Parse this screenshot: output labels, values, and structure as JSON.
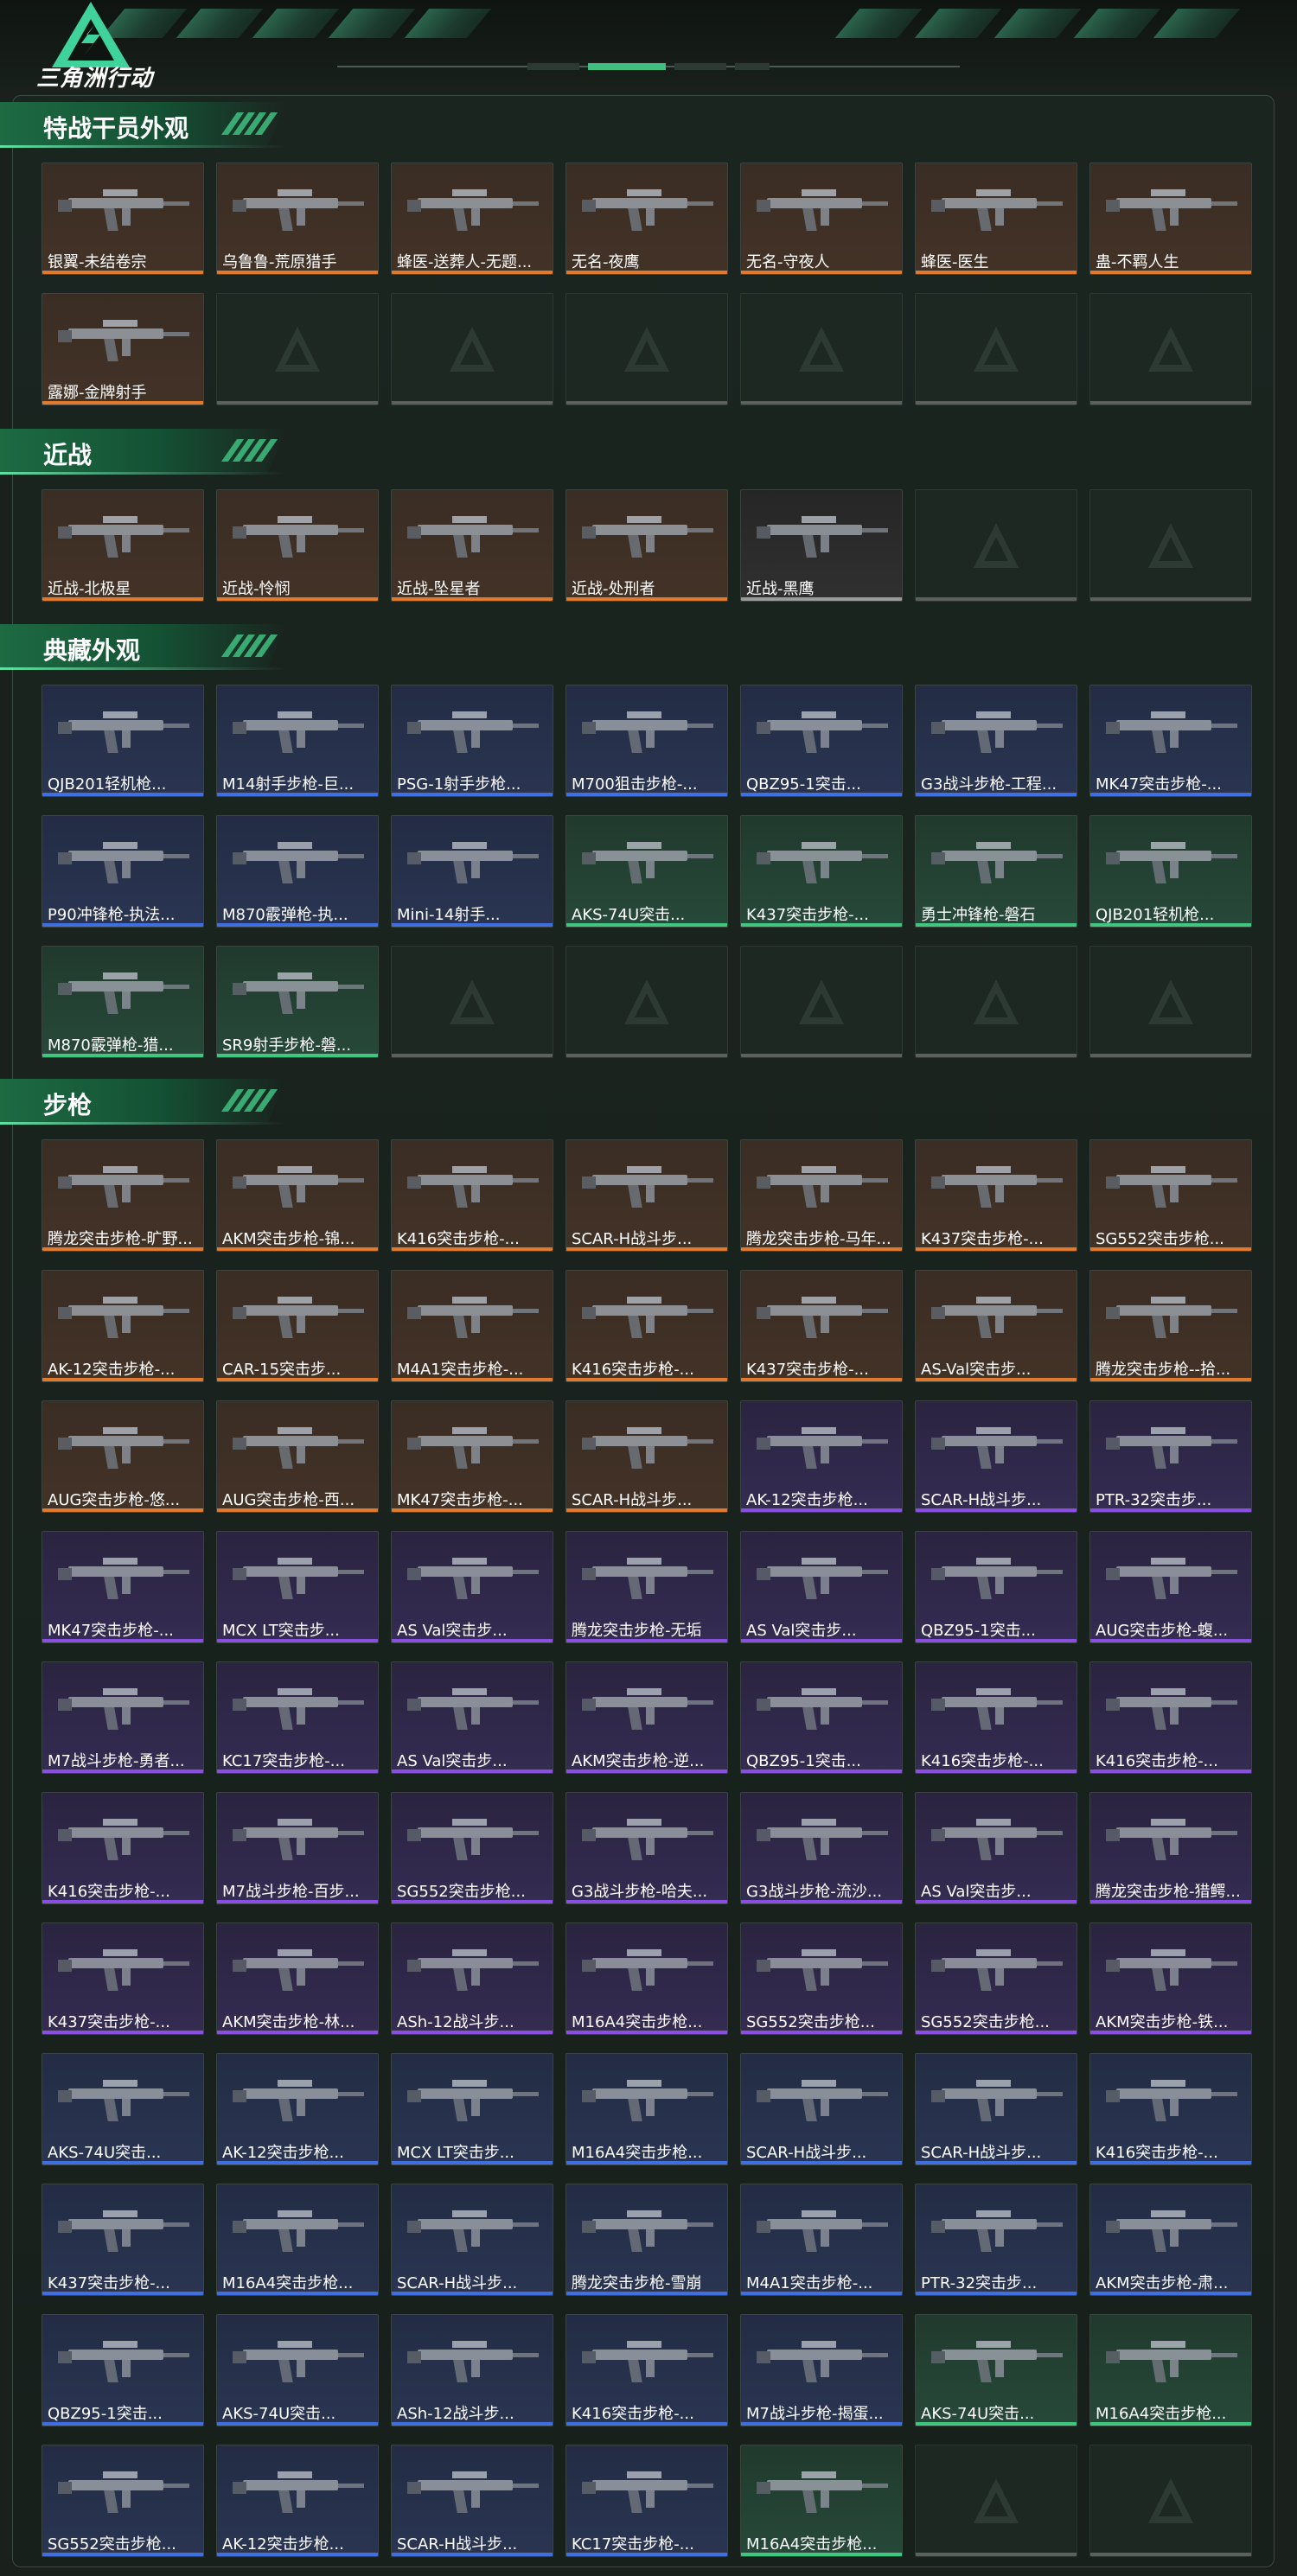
{
  "header": {
    "logo_text": "三角洲行动"
  },
  "colors": {
    "orange": "#e07a2e",
    "blue": "#3f6fe0",
    "green": "#3ec77d",
    "purple": "#8a4fe0",
    "gray": "#9a9a9a",
    "accent": "#1d6a43"
  },
  "sections": [
    {
      "title": "特战干员外观",
      "items": [
        {
          "label": "银翼-未结卷宗",
          "tier": "orange"
        },
        {
          "label": "乌鲁鲁-荒原猎手",
          "tier": "orange"
        },
        {
          "label": "蜂医-送葬人-无题...",
          "tier": "orange"
        },
        {
          "label": "无名-夜鹰",
          "tier": "orange"
        },
        {
          "label": "无名-守夜人",
          "tier": "orange"
        },
        {
          "label": "蜂医-医生",
          "tier": "orange"
        },
        {
          "label": "蛊-不羁人生",
          "tier": "orange"
        },
        {
          "label": "露娜-金牌射手",
          "tier": "orange"
        },
        {
          "label": "",
          "tier": "empty"
        },
        {
          "label": "",
          "tier": "empty"
        },
        {
          "label": "",
          "tier": "empty"
        },
        {
          "label": "",
          "tier": "empty"
        },
        {
          "label": "",
          "tier": "empty"
        },
        {
          "label": "",
          "tier": "empty"
        }
      ]
    },
    {
      "title": "近战",
      "items": [
        {
          "label": "近战-北极星",
          "tier": "orange"
        },
        {
          "label": "近战-怜悯",
          "tier": "orange"
        },
        {
          "label": "近战-坠星者",
          "tier": "orange"
        },
        {
          "label": "近战-处刑者",
          "tier": "orange"
        },
        {
          "label": "近战-黑鹰",
          "tier": "gray"
        },
        {
          "label": "",
          "tier": "empty"
        },
        {
          "label": "",
          "tier": "empty"
        }
      ]
    },
    {
      "title": "典藏外观",
      "items": [
        {
          "label": "QJB201轻机枪...",
          "tier": "blue"
        },
        {
          "label": "M14射手步枪-巨...",
          "tier": "blue"
        },
        {
          "label": "PSG-1射手步枪...",
          "tier": "blue"
        },
        {
          "label": "M700狙击步枪-...",
          "tier": "blue"
        },
        {
          "label": "QBZ95-1突击...",
          "tier": "blue"
        },
        {
          "label": "G3战斗步枪-工程...",
          "tier": "blue"
        },
        {
          "label": "MK47突击步枪-...",
          "tier": "blue"
        },
        {
          "label": "P90冲锋枪-执法...",
          "tier": "blue"
        },
        {
          "label": "M870霰弹枪-执...",
          "tier": "blue"
        },
        {
          "label": "Mini-14射手...",
          "tier": "blue"
        },
        {
          "label": "AKS-74U突击...",
          "tier": "green"
        },
        {
          "label": "K437突击步枪-...",
          "tier": "green"
        },
        {
          "label": "勇士冲锋枪-磐石",
          "tier": "green"
        },
        {
          "label": "QJB201轻机枪...",
          "tier": "green"
        },
        {
          "label": "M870霰弹枪-猎...",
          "tier": "green"
        },
        {
          "label": "SR9射手步枪-磐...",
          "tier": "green"
        },
        {
          "label": "",
          "tier": "empty"
        },
        {
          "label": "",
          "tier": "empty"
        },
        {
          "label": "",
          "tier": "empty"
        },
        {
          "label": "",
          "tier": "empty"
        },
        {
          "label": "",
          "tier": "empty"
        }
      ]
    },
    {
      "title": "步枪",
      "items": [
        {
          "label": "腾龙突击步枪-旷野...",
          "tier": "orange"
        },
        {
          "label": "AKM突击步枪-锦...",
          "tier": "orange"
        },
        {
          "label": "K416突击步枪-...",
          "tier": "orange"
        },
        {
          "label": "SCAR-H战斗步...",
          "tier": "orange"
        },
        {
          "label": "腾龙突击步枪-马年...",
          "tier": "orange"
        },
        {
          "label": "K437突击步枪-...",
          "tier": "orange"
        },
        {
          "label": "SG552突击步枪...",
          "tier": "orange"
        },
        {
          "label": "AK-12突击步枪-...",
          "tier": "orange"
        },
        {
          "label": "CAR-15突击步...",
          "tier": "orange"
        },
        {
          "label": "M4A1突击步枪-...",
          "tier": "orange"
        },
        {
          "label": "K416突击步枪-...",
          "tier": "orange"
        },
        {
          "label": "K437突击步枪-...",
          "tier": "orange"
        },
        {
          "label": "AS-Val突击步...",
          "tier": "orange"
        },
        {
          "label": "腾龙突击步枪--拾...",
          "tier": "orange"
        },
        {
          "label": "AUG突击步枪-悠...",
          "tier": "orange"
        },
        {
          "label": "AUG突击步枪-西...",
          "tier": "orange"
        },
        {
          "label": "MK47突击步枪-...",
          "tier": "orange"
        },
        {
          "label": "SCAR-H战斗步...",
          "tier": "orange"
        },
        {
          "label": "AK-12突击步枪...",
          "tier": "purple"
        },
        {
          "label": "SCAR-H战斗步...",
          "tier": "purple"
        },
        {
          "label": "PTR-32突击步...",
          "tier": "purple"
        },
        {
          "label": "MK47突击步枪-...",
          "tier": "purple"
        },
        {
          "label": "MCX LT突击步...",
          "tier": "purple"
        },
        {
          "label": "AS Val突击步...",
          "tier": "purple"
        },
        {
          "label": "腾龙突击步枪-无垢",
          "tier": "purple"
        },
        {
          "label": "AS Val突击步...",
          "tier": "purple"
        },
        {
          "label": "QBZ95-1突击...",
          "tier": "purple"
        },
        {
          "label": "AUG突击步枪-蝮...",
          "tier": "purple"
        },
        {
          "label": "M7战斗步枪-勇者...",
          "tier": "purple"
        },
        {
          "label": "KC17突击步枪-...",
          "tier": "purple"
        },
        {
          "label": "AS Val突击步...",
          "tier": "purple"
        },
        {
          "label": "AKM突击步枪-逆...",
          "tier": "purple"
        },
        {
          "label": "QBZ95-1突击...",
          "tier": "purple"
        },
        {
          "label": "K416突击步枪-...",
          "tier": "purple"
        },
        {
          "label": "K416突击步枪-...",
          "tier": "purple"
        },
        {
          "label": "K416突击步枪-...",
          "tier": "purple"
        },
        {
          "label": "M7战斗步枪-百步...",
          "tier": "purple"
        },
        {
          "label": "SG552突击步枪...",
          "tier": "purple"
        },
        {
          "label": "G3战斗步枪-哈夫...",
          "tier": "purple"
        },
        {
          "label": "G3战斗步枪-流沙...",
          "tier": "purple"
        },
        {
          "label": "AS Val突击步...",
          "tier": "purple"
        },
        {
          "label": "腾龙突击步枪-猎鳄...",
          "tier": "purple"
        },
        {
          "label": "K437突击步枪-...",
          "tier": "purple"
        },
        {
          "label": "AKM突击步枪-林...",
          "tier": "purple"
        },
        {
          "label": "ASh-12战斗步...",
          "tier": "purple"
        },
        {
          "label": "M16A4突击步枪...",
          "tier": "purple"
        },
        {
          "label": "SG552突击步枪...",
          "tier": "purple"
        },
        {
          "label": "SG552突击步枪...",
          "tier": "purple"
        },
        {
          "label": "AKM突击步枪-铁...",
          "tier": "purple"
        },
        {
          "label": "AKS-74U突击...",
          "tier": "blue"
        },
        {
          "label": "AK-12突击步枪...",
          "tier": "blue"
        },
        {
          "label": "MCX LT突击步...",
          "tier": "blue"
        },
        {
          "label": "M16A4突击步枪...",
          "tier": "blue"
        },
        {
          "label": "SCAR-H战斗步...",
          "tier": "blue"
        },
        {
          "label": "SCAR-H战斗步...",
          "tier": "blue"
        },
        {
          "label": "K416突击步枪-...",
          "tier": "blue"
        },
        {
          "label": "K437突击步枪-...",
          "tier": "blue"
        },
        {
          "label": "M16A4突击步枪...",
          "tier": "blue"
        },
        {
          "label": "SCAR-H战斗步...",
          "tier": "blue"
        },
        {
          "label": "腾龙突击步枪-雪崩",
          "tier": "blue"
        },
        {
          "label": "M4A1突击步枪-...",
          "tier": "blue"
        },
        {
          "label": "PTR-32突击步...",
          "tier": "blue"
        },
        {
          "label": "AKM突击步枪-肃...",
          "tier": "blue"
        },
        {
          "label": "QBZ95-1突击...",
          "tier": "blue"
        },
        {
          "label": "AKS-74U突击...",
          "tier": "blue"
        },
        {
          "label": "ASh-12战斗步...",
          "tier": "blue"
        },
        {
          "label": "K416突击步枪-...",
          "tier": "blue"
        },
        {
          "label": "M7战斗步枪-揭蛋...",
          "tier": "blue"
        },
        {
          "label": "AKS-74U突击...",
          "tier": "green"
        },
        {
          "label": "M16A4突击步枪...",
          "tier": "green"
        },
        {
          "label": "SG552突击步枪...",
          "tier": "blue"
        },
        {
          "label": "AK-12突击步枪...",
          "tier": "blue"
        },
        {
          "label": "SCAR-H战斗步...",
          "tier": "blue"
        },
        {
          "label": "KC17突击步枪-...",
          "tier": "blue"
        },
        {
          "label": "M16A4突击步枪...",
          "tier": "green"
        },
        {
          "label": "",
          "tier": "empty"
        },
        {
          "label": "",
          "tier": "empty"
        }
      ]
    }
  ]
}
